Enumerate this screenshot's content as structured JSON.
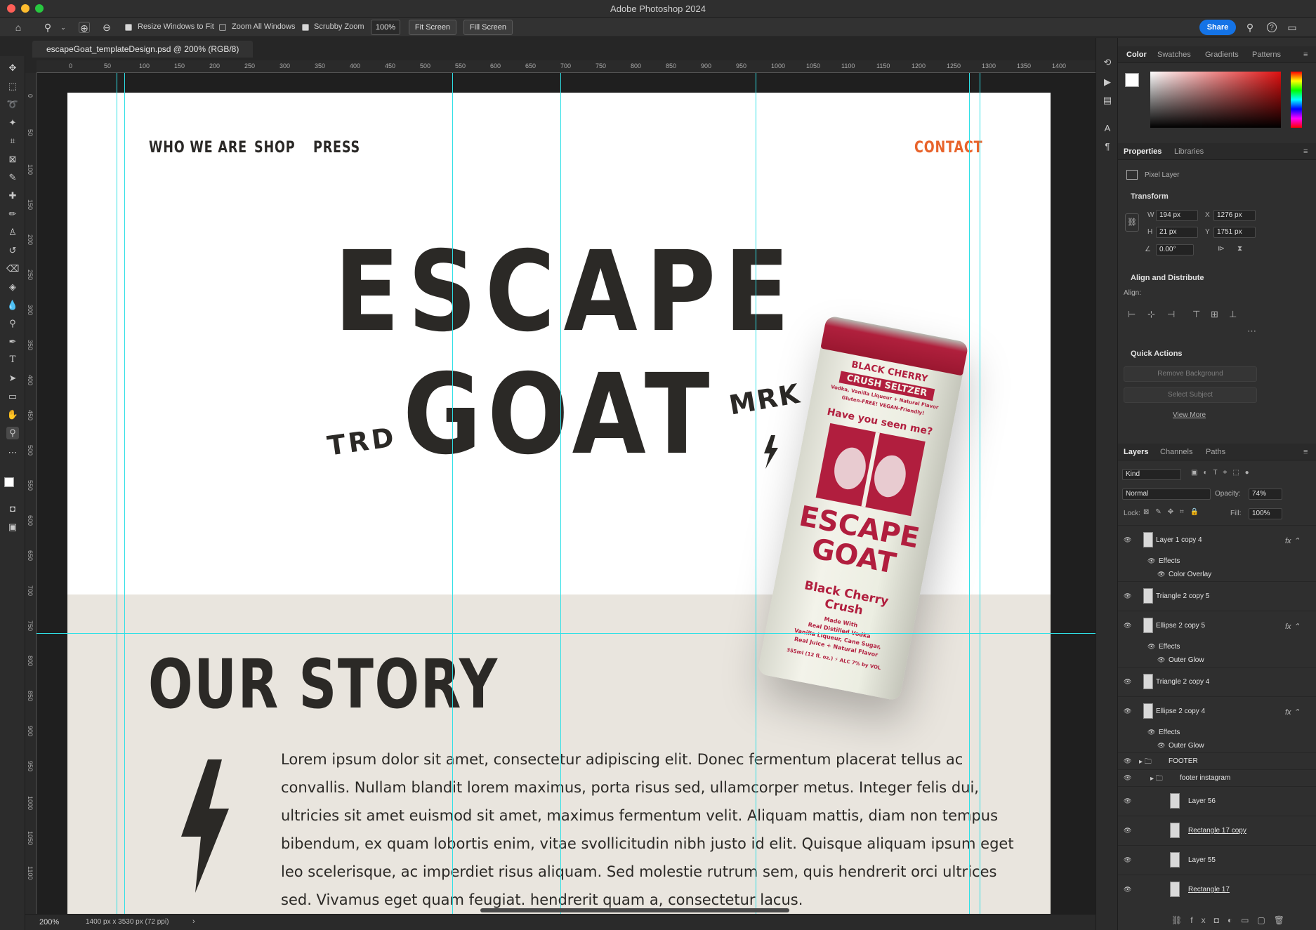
{
  "app": {
    "title": "Adobe Photoshop 2024"
  },
  "options_bar": {
    "resize_windows": "Resize Windows to Fit",
    "resize_checked": true,
    "zoom_all": "Zoom All Windows",
    "zoom_all_checked": false,
    "scrubby_zoom": "Scrubby Zoom",
    "scrubby_checked": true,
    "zoom_value": "100%",
    "fit_screen": "Fit Screen",
    "fill_screen": "Fill Screen",
    "share": "Share"
  },
  "document": {
    "tab_title": "escapeGoat_templateDesign.psd @ 200% (RGB/8)",
    "zoom": "200%",
    "info": "1400 px x 3530 px (72 ppi)"
  },
  "ruler": {
    "h_ticks": [
      "0",
      "50",
      "100",
      "150",
      "200",
      "250",
      "300",
      "350",
      "400",
      "450",
      "500",
      "550",
      "600",
      "650",
      "700",
      "750",
      "800",
      "850",
      "900",
      "950",
      "1000",
      "1050",
      "1100",
      "1150",
      "1200",
      "1250",
      "1300",
      "1350",
      "1400"
    ],
    "v_ticks": [
      "0",
      "50",
      "100",
      "150",
      "200",
      "250",
      "300",
      "350",
      "400",
      "450",
      "500",
      "550",
      "600",
      "650",
      "700",
      "750",
      "800",
      "850",
      "900",
      "950",
      "1000",
      "1050",
      "1100"
    ]
  },
  "site": {
    "nav": [
      "WHO WE ARE",
      "SHOP",
      "PRESS"
    ],
    "contact": "CONTACT",
    "hero_line1": "ESCAPE",
    "hero_line2": "GOAT",
    "trd": "TRD",
    "mrk": "MRK",
    "story_title": "OUR STORY",
    "body": "Lorem ipsum dolor sit amet, consectetur adipiscing elit. Donec fermentum placerat tellus ac convallis. Nullam blandit lorem maximus, porta risus sed, ullamcorper metus. Integer felis dui, ultricies sit amet euismod sit amet, maximus fermentum velit. Aliquam mattis, diam non tempus bibendum, ex quam lobortis enim, vitae svollicitudin nibh justo id elit. Quisque aliquam ipsum eget leo scelerisque, ac imperdiet risus aliquam. Sed molestie rutrum sem, quis hendrerit orci ultrices sed. Vivamus eget quam feugiat. hendrerit quam a, consectetur lacus."
  },
  "can": {
    "line1": "BLACK CHERRY",
    "line2": "CRUSH SELTZER",
    "line3": "Vodka, Vanilla Liqueur + Natural Flavor",
    "line4": "Gluten-FREE! VEGAN-Friendly!",
    "seen": "Have you seen me?",
    "brand1": "ESCAPE",
    "brand2": "GOAT",
    "flavor1": "Black Cherry",
    "flavor2": "Crush",
    "made": "Made With",
    "ing1": "Real Distilled Vodka",
    "ing2": "Vanilla Liqueur, Cane Sugar,",
    "ing3": "Real Juice + Natural Flavor",
    "abv": "355ml (12 fl. oz.) ⚡ ALC 7% by VOL"
  },
  "colors": {
    "accent_orange": "#e8632b",
    "guide": "#2fe0e6",
    "can_red": "#b11e3e",
    "share_blue": "#1473e6"
  },
  "color_panel": {
    "tabs": [
      "Color",
      "Swatches",
      "Gradients",
      "Patterns"
    ]
  },
  "properties_panel": {
    "tabs": [
      "Properties",
      "Libraries"
    ],
    "layer_kind": "Pixel Layer",
    "transform_title": "Transform",
    "w_label": "W",
    "w": "194 px",
    "h_label": "H",
    "h": "21 px",
    "x_label": "X",
    "x": "1276 px",
    "y_label": "Y",
    "y": "1751 px",
    "angle": "0.00°",
    "align_title": "Align and Distribute",
    "align_label": "Align:",
    "quick_actions": "Quick Actions",
    "remove_bg": "Remove Background",
    "select_subject": "Select Subject",
    "view_more": "View More"
  },
  "layers_panel": {
    "tabs": [
      "Layers",
      "Channels",
      "Paths"
    ],
    "kind": "Kind",
    "blend": "Normal",
    "opacity_label": "Opacity:",
    "opacity": "74%",
    "lock_label": "Lock:",
    "fill_label": "Fill:",
    "fill": "100%",
    "layers": [
      {
        "name": "Layer 1 copy 4",
        "fx": true
      },
      {
        "name": "Effects",
        "sub": true
      },
      {
        "name": "Color Overlay",
        "sub2": true
      },
      {
        "name": "Triangle 2 copy 5"
      },
      {
        "name": "Ellipse 2 copy 5",
        "fx": true
      },
      {
        "name": "Effects",
        "sub": true
      },
      {
        "name": "Outer Glow",
        "sub2": true
      },
      {
        "name": "Triangle 2 copy 4"
      },
      {
        "name": "Ellipse 2 copy 4",
        "fx": true
      },
      {
        "name": "Effects",
        "sub": true
      },
      {
        "name": "Outer Glow",
        "sub2": true
      },
      {
        "name": "FOOTER",
        "group": true
      },
      {
        "name": "footer instagram",
        "group": true
      },
      {
        "name": "Layer 56"
      },
      {
        "name": "Rectangle 17 copy",
        "underline": true
      },
      {
        "name": "Layer 55"
      },
      {
        "name": "Rectangle 17",
        "underline": true
      }
    ]
  }
}
